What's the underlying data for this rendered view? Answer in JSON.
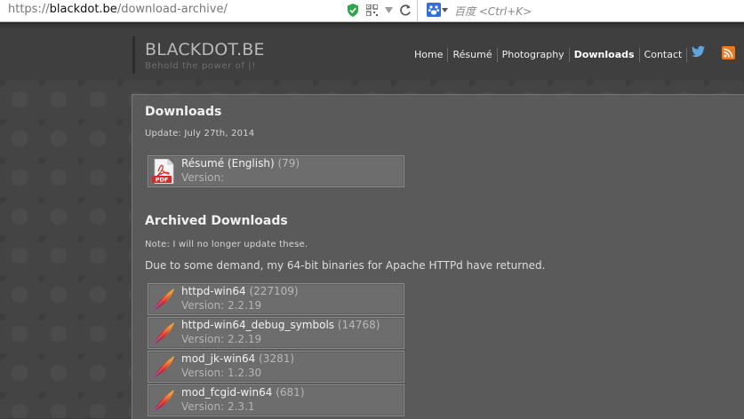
{
  "browser": {
    "url_prefix": "https://",
    "url_host": "blackdot.be",
    "url_path": "/download-archive/",
    "search_placeholder": "百度 <Ctrl+K>"
  },
  "site": {
    "title": "BLACKDOT.BE",
    "tagline": "Behold the power of |!"
  },
  "nav": {
    "items": [
      {
        "label": "Home",
        "active": false
      },
      {
        "label": "Résumé",
        "active": false
      },
      {
        "label": "Photography",
        "active": false
      },
      {
        "label": "Downloads",
        "active": true
      },
      {
        "label": "Contact",
        "active": false
      }
    ],
    "icons": [
      "twitter-icon",
      "rss-icon"
    ]
  },
  "downloads": {
    "heading": "Downloads",
    "update_note": "Update: July 27th, 2014",
    "items": [
      {
        "icon": "pdf-icon",
        "name": "Résumé (English)",
        "count": "(79)",
        "version": "Version:"
      }
    ]
  },
  "archived": {
    "heading": "Archived Downloads",
    "note": "Note: I will no longer update these.",
    "intro": "Due to some demand, my 64-bit binaries for Apache HTTPd have returned.",
    "items": [
      {
        "icon": "apache-feather-icon",
        "name": "httpd-win64",
        "count": "(227109)",
        "version": "Version: 2.2.19"
      },
      {
        "icon": "apache-feather-icon",
        "name": "httpd-win64_debug_symbols",
        "count": "(14768)",
        "version": "Version: 2.2.19"
      },
      {
        "icon": "apache-feather-icon",
        "name": "mod_jk-win64",
        "count": "(3281)",
        "version": "Version: 1.2.30"
      },
      {
        "icon": "apache-feather-icon",
        "name": "mod_fcgid-win64",
        "count": "(681)",
        "version": "Version: 2.3.1"
      }
    ]
  },
  "colors": {
    "accent_rss": "#e9771f",
    "search_engine_blue": "#2f6fd8",
    "pdf_red": "#d42a2a"
  }
}
